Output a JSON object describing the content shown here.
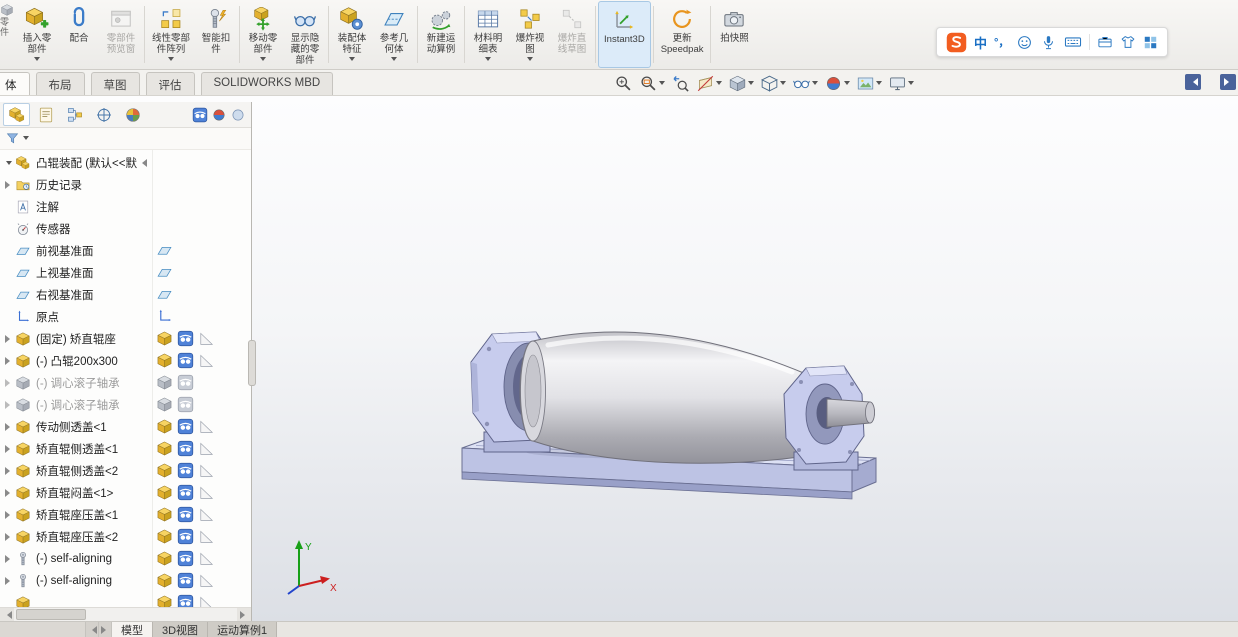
{
  "ribbon": {
    "partial_left_label": "零件",
    "items": [
      {
        "id": "insert-component",
        "icon": "insert-component",
        "lines": [
          "插入零",
          "部件"
        ],
        "dropdown": true
      },
      {
        "id": "mate",
        "icon": "mate",
        "lines": [
          "配合"
        ]
      },
      {
        "id": "component-preview-window",
        "icon": "preview-window",
        "lines": [
          "零部件",
          "预览窗"
        ],
        "disabled": true
      },
      {
        "id": "linear-component-pattern",
        "icon": "linear-pattern",
        "lines": [
          "线性零部",
          "件阵列"
        ],
        "dropdown": true,
        "sep_before": true
      },
      {
        "id": "smart-fasteners",
        "icon": "smart-fastener",
        "lines": [
          "智能扣",
          "件"
        ]
      },
      {
        "id": "move-component",
        "icon": "move-component",
        "lines": [
          "移动零",
          "部件"
        ],
        "dropdown": true,
        "sep_before": true
      },
      {
        "id": "show-hidden-components",
        "icon": "show-hidden",
        "lines": [
          "显示隐",
          "藏的零",
          "部件"
        ]
      },
      {
        "id": "assembly-features",
        "icon": "assembly-features",
        "lines": [
          "装配体",
          "特征"
        ],
        "dropdown": true,
        "sep_before": true
      },
      {
        "id": "reference-geometry",
        "icon": "reference-geometry",
        "lines": [
          "参考几",
          "何体"
        ],
        "dropdown": true
      },
      {
        "id": "new-motion-study",
        "icon": "motion-study",
        "lines": [
          "新建运",
          "动算例"
        ],
        "sep_before": true
      },
      {
        "id": "bill-of-materials",
        "icon": "bom",
        "lines": [
          "材料明",
          "细表"
        ],
        "dropdown": true,
        "sep_before": true
      },
      {
        "id": "exploded-view",
        "icon": "exploded-view",
        "lines": [
          "爆炸视",
          "图"
        ],
        "dropdown": true
      },
      {
        "id": "explode-line-sketch",
        "icon": "explode-sketch",
        "lines": [
          "爆炸直",
          "线草图"
        ],
        "disabled": true
      },
      {
        "id": "instant3d",
        "icon": "instant3d",
        "lines": [
          "Instant3D"
        ],
        "pressed": true,
        "sep_before": true
      },
      {
        "id": "update-speedpak",
        "icon": "speedpak",
        "lines": [
          "更新",
          "Speedpak"
        ],
        "sep_before": true
      },
      {
        "id": "take-snapshot",
        "icon": "snapshot",
        "lines": [
          "拍快照"
        ],
        "sep_before": true
      }
    ]
  },
  "ime_bar": {
    "logo_letter": "S",
    "lang_label": "中",
    "punct_label": "°，"
  },
  "command_tabs": [
    {
      "id": "assembly",
      "label": "体",
      "active": true,
      "partial": true
    },
    {
      "id": "layout",
      "label": "布局"
    },
    {
      "id": "sketch",
      "label": "草图"
    },
    {
      "id": "evaluate",
      "label": "评估"
    },
    {
      "id": "solidworks-mbd",
      "label": "SOLIDWORKS MBD"
    }
  ],
  "view_toolbar": [
    {
      "id": "zoom-to-fit",
      "icon": "zoom-fit"
    },
    {
      "id": "zoom-to-area",
      "icon": "zoom-area",
      "dropdown": true
    },
    {
      "id": "previous-view",
      "icon": "previous-view"
    },
    {
      "id": "section-view",
      "icon": "section-view",
      "dropdown": true
    },
    {
      "id": "view-orientation",
      "icon": "view-cube",
      "dropdown": true
    },
    {
      "id": "display-style",
      "icon": "display-style",
      "dropdown": true
    },
    {
      "id": "hide-show-items",
      "icon": "hide-show",
      "dropdown": true
    },
    {
      "id": "edit-appearance",
      "icon": "appearance",
      "dropdown": true
    },
    {
      "id": "apply-scene",
      "icon": "scene",
      "dropdown": true
    },
    {
      "id": "view-settings",
      "icon": "monitor",
      "dropdown": true
    }
  ],
  "panel": {
    "tabs": [
      {
        "id": "featuremanager",
        "icon": "pt-feature",
        "active": true
      },
      {
        "id": "propertymanager",
        "icon": "pt-property"
      },
      {
        "id": "configurationmanager",
        "icon": "pt-config"
      },
      {
        "id": "dimxpertmanager",
        "icon": "pt-dimxpert"
      },
      {
        "id": "displaymanager",
        "icon": "pt-display"
      }
    ],
    "pane_header_icons": [
      "eye-header",
      "appearance-header",
      "transparency-header"
    ],
    "tree": [
      {
        "label": "凸辊装配 (默认<<默",
        "icon": "assembly",
        "arrow": "down",
        "root": true
      },
      {
        "label": "历史记录",
        "icon": "history",
        "arrow": "right"
      },
      {
        "label": "注解",
        "icon": "annotations"
      },
      {
        "label": "传感器",
        "icon": "sensors"
      },
      {
        "label": "前视基准面",
        "icon": "plane",
        "pane": "plane"
      },
      {
        "label": "上视基准面",
        "icon": "plane",
        "pane": "plane"
      },
      {
        "label": "右视基准面",
        "icon": "plane",
        "pane": "plane"
      },
      {
        "label": "原点",
        "icon": "origin",
        "pane": "origin"
      },
      {
        "label": "(固定) 矫直辊座",
        "icon": "part",
        "arrow": "right",
        "pane": "comp"
      },
      {
        "label": "(-) 凸辊200x300",
        "icon": "part",
        "arrow": "right",
        "pane": "comp"
      },
      {
        "label": "(-) 调心滚子轴承",
        "icon": "part-gray",
        "arrow": "right",
        "gray": true,
        "pane": "comp-gray"
      },
      {
        "label": "(-) 调心滚子轴承",
        "icon": "part-gray",
        "arrow": "right",
        "gray": true,
        "pane": "comp-gray"
      },
      {
        "label": "传动侧透盖<1",
        "icon": "part",
        "arrow": "right",
        "pane": "comp"
      },
      {
        "label": "矫直辊侧透盖<1",
        "icon": "part",
        "arrow": "right",
        "pane": "comp"
      },
      {
        "label": "矫直辊侧透盖<2",
        "icon": "part",
        "arrow": "right",
        "pane": "comp"
      },
      {
        "label": "矫直辊闷盖<1>",
        "icon": "part",
        "arrow": "right",
        "pane": "comp"
      },
      {
        "label": "矫直辊座压盖<1",
        "icon": "part",
        "arrow": "right",
        "pane": "comp"
      },
      {
        "label": "矫直辊座压盖<2",
        "icon": "part",
        "arrow": "right",
        "pane": "comp"
      },
      {
        "label": "(-) self-aligning",
        "icon": "bolt",
        "arrow": "right",
        "pane": "comp"
      },
      {
        "label": "(-) self-aligning",
        "icon": "bolt",
        "arrow": "right",
        "pane": "comp"
      },
      {
        "label": "",
        "icon": "part",
        "pane": "comp",
        "partial": true
      }
    ]
  },
  "viewport": {
    "triad": {
      "x_label": "X",
      "y_label": "Y"
    },
    "colors": {
      "housing": "#c7cced",
      "rail_front": "#bdc3e4",
      "barrel_light": "#f4f4f6",
      "barrel_dark": "#93939b"
    }
  },
  "status_bar": {
    "tabs": [
      {
        "label": "模型",
        "active": true
      },
      {
        "label": "3D视图"
      },
      {
        "label": "运动算例1"
      }
    ]
  }
}
